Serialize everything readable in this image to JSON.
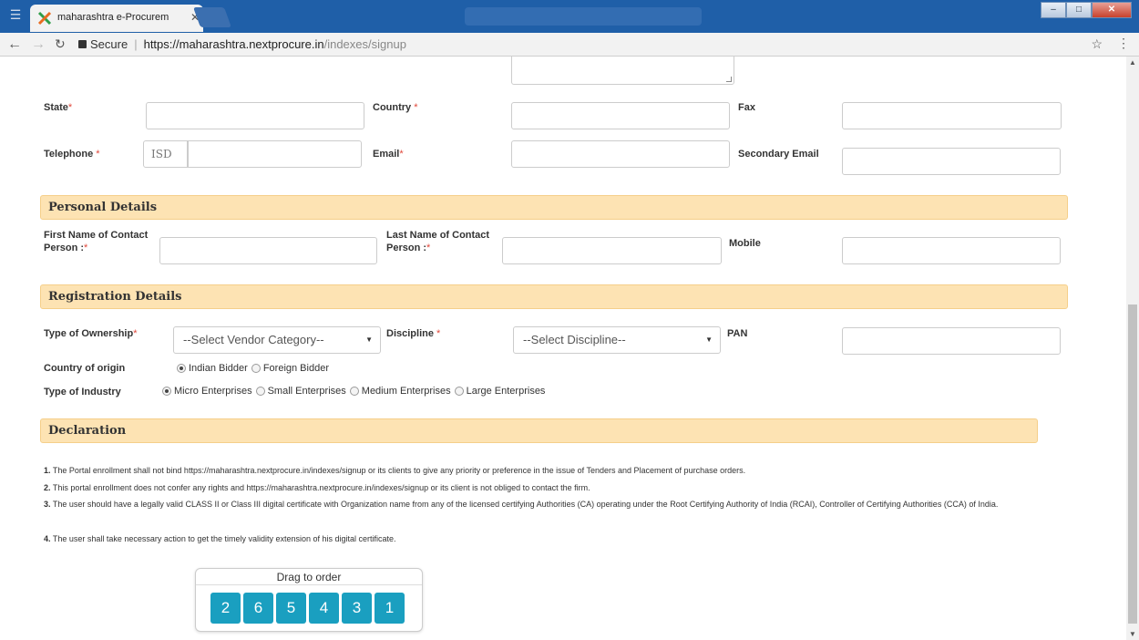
{
  "browser": {
    "tab_title": "maharashtra e-Procurem",
    "secure_label": "Secure",
    "url_host": "https://maharashtra.nextprocure.in",
    "url_path": "/indexes/signup"
  },
  "contact": {
    "state_label": "State",
    "country_label": "Country",
    "fax_label": "Fax",
    "telephone_label": "Telephone",
    "isd_placeholder": "ISD",
    "email_label": "Email",
    "secondary_email_label": "Secondary Email",
    "required_mark": "*"
  },
  "personal": {
    "title": "Personal Details",
    "first_name_label_1": "First Name of Contact",
    "first_name_label_2": "Person :",
    "last_name_label_1": "Last Name of Contact",
    "last_name_label_2": "Person :",
    "mobile_label": "Mobile"
  },
  "registration": {
    "title": "Registration Details",
    "ownership_label": "Type of Ownership",
    "ownership_value": "--Select Vendor Category--",
    "discipline_label": "Discipline",
    "discipline_value": "--Select Discipline--",
    "pan_label": "PAN",
    "origin_label": "Country of origin",
    "origin_options": [
      "Indian Bidder",
      "Foreign Bidder"
    ],
    "origin_selected": "Indian Bidder",
    "industry_label": "Type of Industry",
    "industry_options": [
      "Micro Enterprises",
      "Small Enterprises",
      "Medium Enterprises",
      "Large Enterprises"
    ],
    "industry_selected": "Micro Enterprises"
  },
  "declaration": {
    "title": "Declaration",
    "items": [
      {
        "num": "1.",
        "text": " The Portal enrollment shall not bind https://maharashtra.nextprocure.in/indexes/signup or its clients to give any priority or preference in the issue of Tenders and Placement of purchase orders."
      },
      {
        "num": "2.",
        "text": " This portal enrollment does not confer any rights and https://maharashtra.nextprocure.in/indexes/signup or its client is not obliged to contact the firm."
      },
      {
        "num": "3.",
        "text": " The user should have a legally valid CLASS II or Class III digital certificate with Organization name from any of the licensed certifying Authorities (CA) operating under the Root Certifying Authority of India (RCAI), Controller of Certifying Authorities (CCA) of India."
      },
      {
        "num": "4.",
        "text": " The user shall take necessary action to get the timely validity extension of his digital certificate."
      }
    ]
  },
  "captcha": {
    "title": "Drag to order",
    "tiles": [
      "2",
      "6",
      "5",
      "4",
      "3",
      "1"
    ],
    "tile_color": "#1a9fc0"
  },
  "colors": {
    "section_bg": "#fde3b3",
    "required": "#e0473a"
  }
}
